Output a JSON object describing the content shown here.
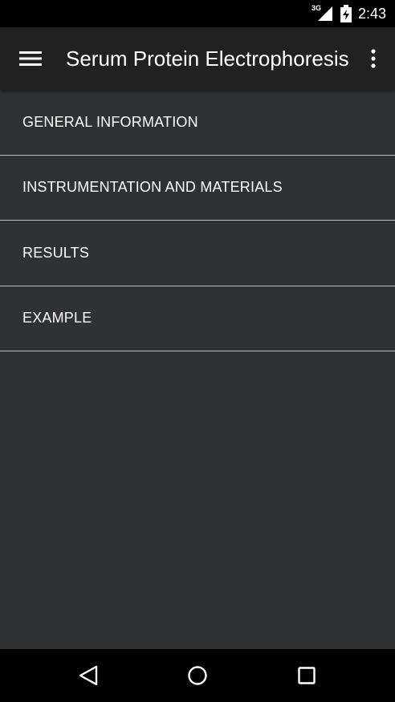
{
  "status_bar": {
    "network_type": "3G",
    "time": "2:43",
    "icons": [
      "signal-icon",
      "battery-charging-icon"
    ]
  },
  "app_bar": {
    "title": "Serum Protein Electrophoresis",
    "menu_icon": "menu-icon",
    "overflow_icon": "more-vert-icon"
  },
  "list": {
    "items": [
      {
        "label": "GENERAL INFORMATION"
      },
      {
        "label": "INSTRUMENTATION AND MATERIALS"
      },
      {
        "label": "RESULTS"
      },
      {
        "label": "EXAMPLE"
      }
    ]
  },
  "nav_bar": {
    "icons": [
      "back-icon",
      "home-icon",
      "recents-icon"
    ]
  },
  "colors": {
    "background": "#303133",
    "app_bar": "#212121",
    "divider": "#bdbdbd",
    "text": "#ffffff",
    "system_bars": "#000000"
  }
}
